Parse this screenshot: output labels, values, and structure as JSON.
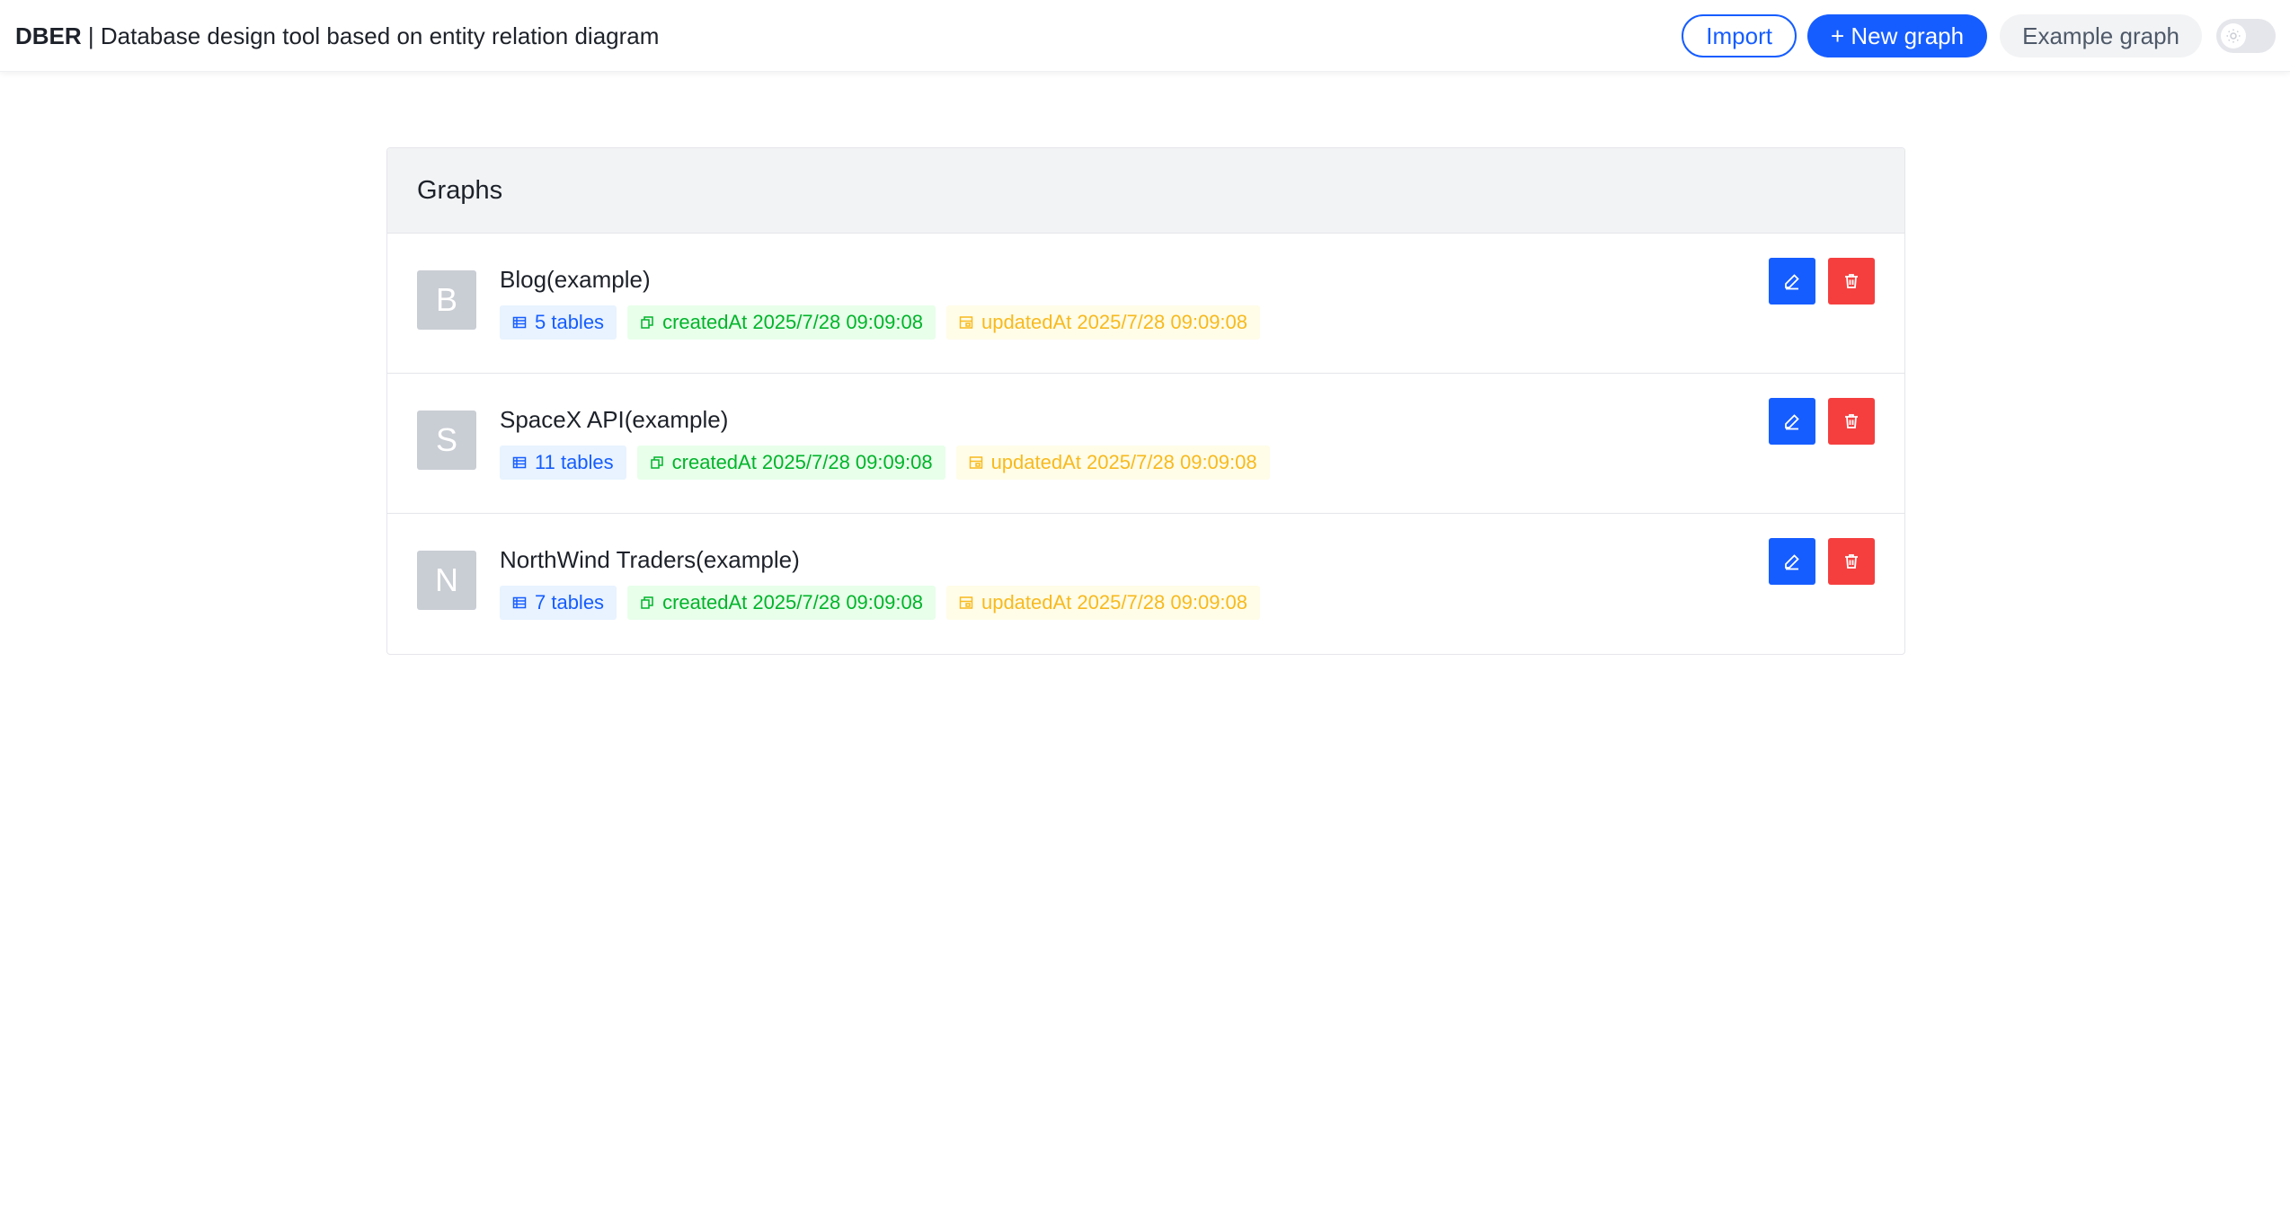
{
  "header": {
    "brand": "DBER",
    "separator": " | ",
    "subtitle": "Database design tool based on entity relation diagram",
    "import_label": "Import",
    "new_graph_label": "+ New graph",
    "example_graph_label": "Example graph",
    "theme_toggle": {
      "state": "off",
      "icon": "sun-icon"
    }
  },
  "graphs": {
    "title": "Graphs",
    "items": [
      {
        "initial": "B",
        "name": "Blog(example)",
        "tables": "5 tables",
        "created": "createdAt 2025/7/28 09:09:08",
        "updated": "updatedAt 2025/7/28 09:09:08"
      },
      {
        "initial": "S",
        "name": "SpaceX API(example)",
        "tables": "11 tables",
        "created": "createdAt 2025/7/28 09:09:08",
        "updated": "updatedAt 2025/7/28 09:09:08"
      },
      {
        "initial": "N",
        "name": "NorthWind Traders(example)",
        "tables": "7 tables",
        "created": "createdAt 2025/7/28 09:09:08",
        "updated": "updatedAt 2025/7/28 09:09:08"
      }
    ]
  },
  "colors": {
    "primary": "#165dff",
    "danger": "#f53f3f",
    "tag_blue_text": "#165dff",
    "tag_green_text": "#00b42a",
    "tag_yellow_text": "#f7ba1e",
    "avatar_bg": "#c9cdd4"
  }
}
